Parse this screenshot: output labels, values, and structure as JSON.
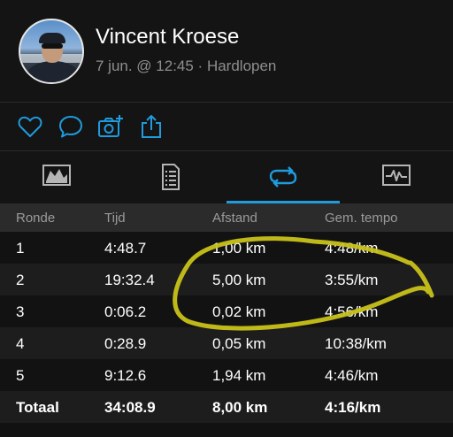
{
  "header": {
    "user_name": "Vincent Kroese",
    "meta": "7 jun. @ 12:45 · Hardlopen"
  },
  "actions": [
    {
      "icon": "heart-icon"
    },
    {
      "icon": "comment-icon"
    },
    {
      "icon": "add-photo-icon"
    },
    {
      "icon": "share-icon"
    }
  ],
  "tabs": [
    {
      "icon": "map-summary-icon",
      "active": false
    },
    {
      "icon": "details-list-icon",
      "active": false
    },
    {
      "icon": "laps-icon",
      "active": true
    },
    {
      "icon": "chart-icon",
      "active": false
    }
  ],
  "colors": {
    "accent": "#1f9bde",
    "highlight_scribble": "#c9c21a"
  },
  "laps_table": {
    "columns": [
      "Ronde",
      "Tijd",
      "Afstand",
      "Gem. tempo"
    ],
    "rows": [
      {
        "lap": "1",
        "time": "4:48.7",
        "distance": "1,00 km",
        "pace": "4:48/km"
      },
      {
        "lap": "2",
        "time": "19:32.4",
        "distance": "5,00 km",
        "pace": "3:55/km"
      },
      {
        "lap": "3",
        "time": "0:06.2",
        "distance": "0,02 km",
        "pace": "4:56/km"
      },
      {
        "lap": "4",
        "time": "0:28.9",
        "distance": "0,05 km",
        "pace": "10:38/km"
      },
      {
        "lap": "5",
        "time": "9:12.6",
        "distance": "1,94 km",
        "pace": "4:46/km"
      }
    ],
    "total": {
      "label": "Totaal",
      "time": "34:08.9",
      "distance": "8,00 km",
      "pace": "4:16/km"
    }
  }
}
